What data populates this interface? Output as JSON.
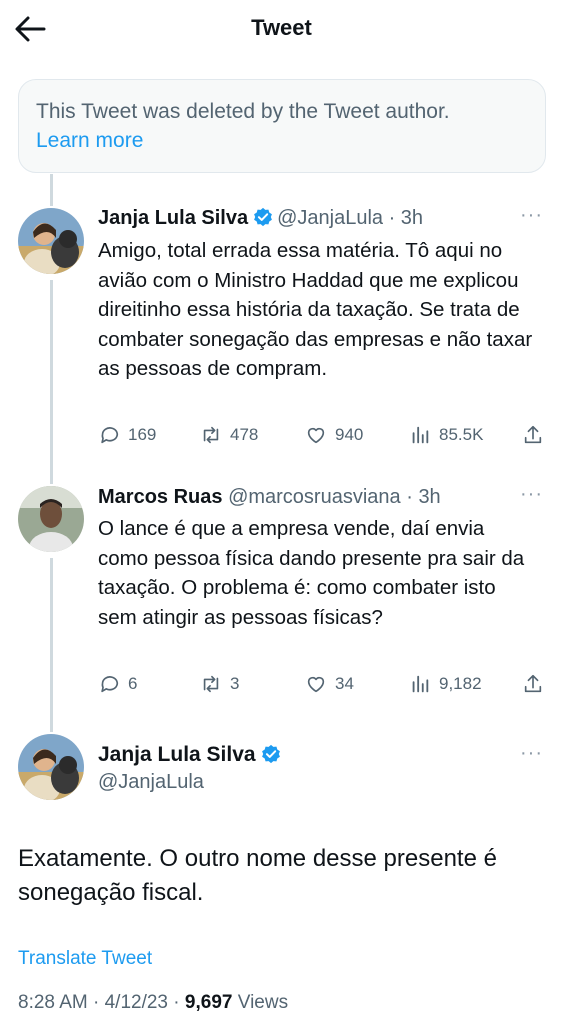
{
  "header": {
    "title": "Tweet"
  },
  "deleted_notice": {
    "text": "This Tweet was deleted by the Tweet author.",
    "link": "Learn more"
  },
  "tweets": [
    {
      "name": "Janja Lula Silva",
      "handle": "@JanjaLula",
      "time": "3h",
      "text": "Amigo, total errada essa matéria. Tô aqui no avião com o Ministro Haddad que me explicou direitinho essa história da taxação. Se trata de combater sonegação das empresas e não taxar as pessoas de compram.",
      "replies": "169",
      "retweets": "478",
      "likes": "940",
      "views": "85.5K"
    },
    {
      "name": "Marcos Ruas",
      "handle": "@marcosruasviana",
      "time": "3h",
      "text": "O lance é que a empresa vende, daí envia como pessoa física dando presente pra sair da taxação. O problema é: como combater isto sem atingir as pessoas físicas?",
      "replies": "6",
      "retweets": "3",
      "likes": "34",
      "views": "9,182"
    }
  ],
  "main_tweet": {
    "name": "Janja Lula Silva",
    "handle": "@JanjaLula",
    "text": "Exatamente. O outro nome desse presente é sonegação fiscal.",
    "translate": "Translate Tweet",
    "time": "8:28 AM",
    "date": "4/12/23",
    "views_count": "9,697",
    "views_label": "Views"
  },
  "colors": {
    "accent": "#1d9bf0",
    "secondary_text": "#536471",
    "thread_line": "#cfd9de"
  },
  "icons": [
    "back-arrow-icon",
    "verified-badge-icon",
    "more-icon",
    "reply-icon",
    "retweet-icon",
    "like-icon",
    "views-icon",
    "share-icon"
  ]
}
